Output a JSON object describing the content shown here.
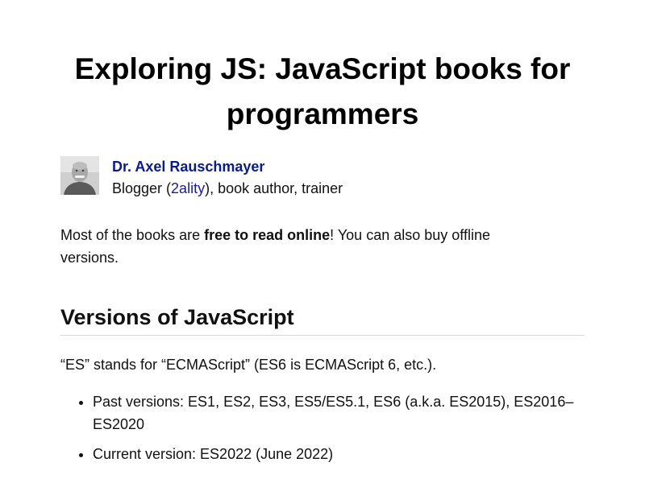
{
  "page": {
    "title": "Exploring JS: JavaScript books for programmers"
  },
  "author": {
    "name": "Dr. Axel Rauschmayer",
    "desc_prefix": "Blogger (",
    "blog_link": "2ality",
    "desc_suffix": "), book author, trainer"
  },
  "intro": {
    "prefix": "Most of the books are ",
    "bold": "free to read online",
    "suffix": "! You can also buy offline versions."
  },
  "section": {
    "title": "Versions of JavaScript",
    "note": "“ES” stands for “ECMAScript” (ES6 is ECMAScript 6, etc.).",
    "items": [
      "Past versions: ES1, ES2, ES3, ES5/ES5.1, ES6 (a.k.a. ES2015), ES2016–ES2020",
      "Current version: ES2022 (June 2022)"
    ]
  },
  "colors": {
    "link": "#0a1b8a",
    "text": "#111111",
    "rule": "#d7d7d7"
  }
}
